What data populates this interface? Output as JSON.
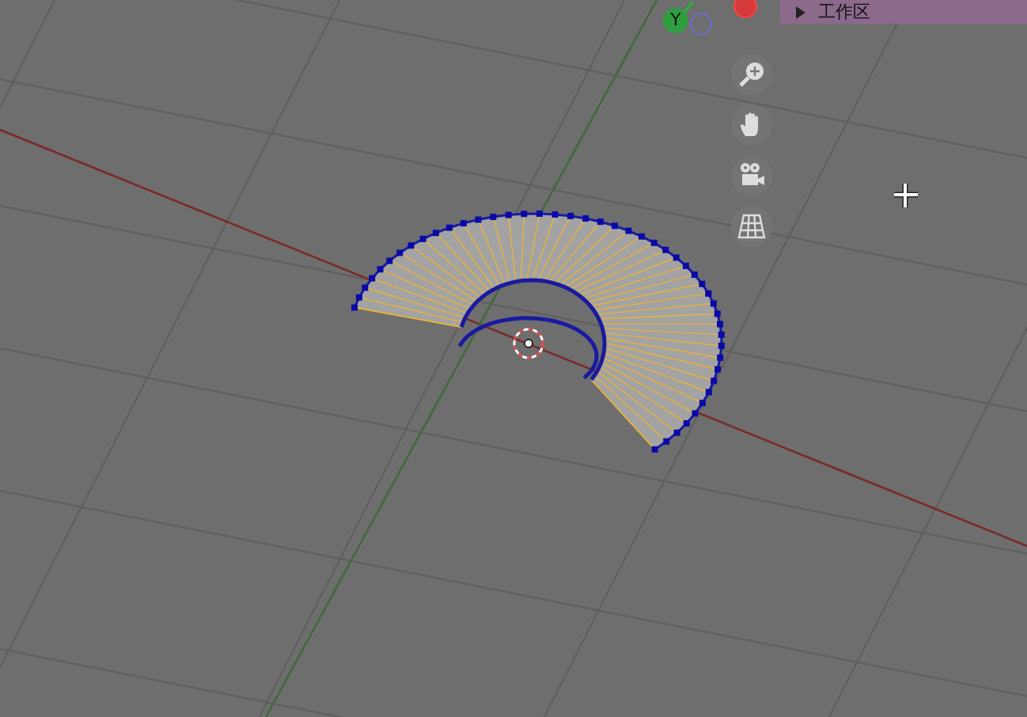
{
  "outliner_row": {
    "expanded": false,
    "label": "工作区"
  },
  "gizmo": {
    "y_label": "Y"
  },
  "nav_tools": [
    {
      "kind": "zoom"
    },
    {
      "kind": "pan"
    },
    {
      "kind": "camera"
    },
    {
      "kind": "grid"
    }
  ]
}
